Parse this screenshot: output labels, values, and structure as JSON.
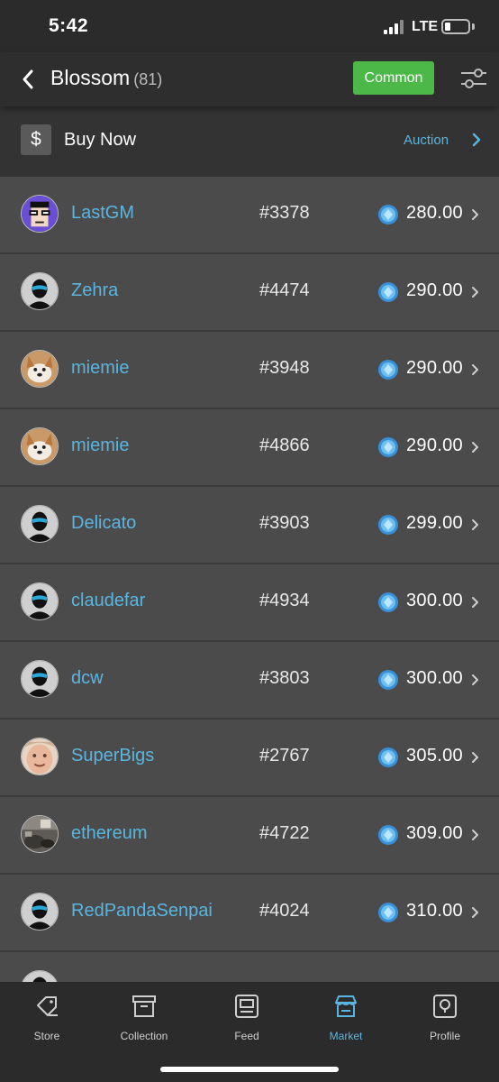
{
  "status_bar": {
    "time": "5:42",
    "network": "LTE",
    "signal_icon": "signal-bars-icon",
    "battery_icon": "battery-icon"
  },
  "nav": {
    "title": "Blossom",
    "count": "(81)",
    "filter_label": "Common",
    "back_icon": "chevron-left-icon",
    "filter_icon": "sliders-icon",
    "accent_color": "#4cb848"
  },
  "mode_bar": {
    "buy_icon": "dollar-icon",
    "buy_label": "Buy Now",
    "auction_label": "Auction",
    "auction_icon": "chevron-right-icon"
  },
  "listings": [
    {
      "seller": "LastGM",
      "token": "#3378",
      "price": "280.00",
      "avatar": "pixel-glasses-avatar"
    },
    {
      "seller": "Zehra",
      "token": "#4474",
      "price": "290.00",
      "avatar": "masked-silhouette-avatar"
    },
    {
      "seller": "miemie",
      "token": "#3948",
      "price": "290.00",
      "avatar": "corgi-photo-avatar"
    },
    {
      "seller": "miemie",
      "token": "#4866",
      "price": "290.00",
      "avatar": "corgi-photo-avatar"
    },
    {
      "seller": "Delicato",
      "token": "#3903",
      "price": "299.00",
      "avatar": "masked-silhouette-avatar"
    },
    {
      "seller": "claudefar",
      "token": "#4934",
      "price": "300.00",
      "avatar": "masked-silhouette-avatar"
    },
    {
      "seller": "dcw",
      "token": "#3803",
      "price": "300.00",
      "avatar": "masked-silhouette-avatar"
    },
    {
      "seller": "SuperBigs",
      "token": "#2767",
      "price": "305.00",
      "avatar": "face-photo-avatar"
    },
    {
      "seller": "ethereum",
      "token": "#4722",
      "price": "309.00",
      "avatar": "room-photo-avatar"
    },
    {
      "seller": "RedPandaSenpai",
      "token": "#4024",
      "price": "310.00",
      "avatar": "masked-silhouette-avatar"
    }
  ],
  "colors": {
    "link": "#5ab6e0",
    "coin": "#4aa3e8",
    "row_bg": "#4b4b4b",
    "bar_bg": "#2b2b2b"
  },
  "tab_bar": {
    "active": "Market",
    "tabs": [
      {
        "label": "Store",
        "icon": "tag-icon"
      },
      {
        "label": "Collection",
        "icon": "archive-box-icon"
      },
      {
        "label": "Feed",
        "icon": "feed-icon"
      },
      {
        "label": "Market",
        "icon": "storefront-icon"
      },
      {
        "label": "Profile",
        "icon": "profile-icon"
      }
    ]
  }
}
